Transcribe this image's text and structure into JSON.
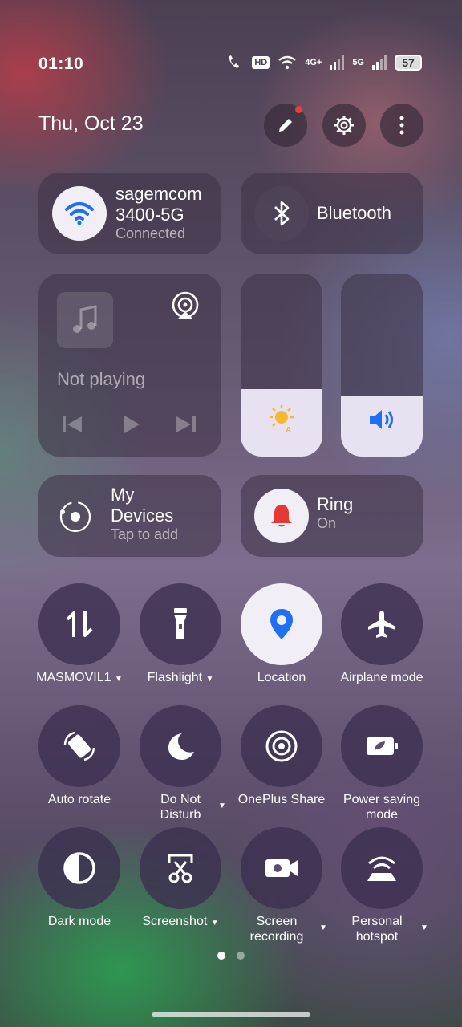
{
  "status_bar": {
    "time": "01:10",
    "hd": "HD",
    "net1": "4G+",
    "net2": "5G",
    "battery": "57"
  },
  "header": {
    "date": "Thu, Oct 23"
  },
  "wifi": {
    "name_line1": "sagemcom",
    "name_line2": "3400-5G",
    "status": "Connected"
  },
  "bluetooth": {
    "label": "Bluetooth"
  },
  "media": {
    "status": "Not playing"
  },
  "sliders": {
    "brightness_level": 0.37,
    "volume_level": 0.33
  },
  "devices": {
    "title_line1": "My",
    "title_line2": "Devices",
    "sub": "Tap to add"
  },
  "ring": {
    "title": "Ring",
    "sub": "On"
  },
  "tiles": {
    "mobile_data": "MASMOVIL1",
    "flashlight": "Flashlight",
    "location": "Location",
    "airplane": "Airplane mode",
    "auto_rotate": "Auto rotate",
    "dnd_line1": "Do Not",
    "dnd_line2": "Disturb",
    "oneplus_share": "OnePlus Share",
    "power_line1": "Power saving",
    "power_line2": "mode",
    "dark_mode": "Dark mode",
    "screenshot": "Screenshot",
    "rec_line1": "Screen",
    "rec_line2": "recording",
    "hotspot_line1": "Personal",
    "hotspot_line2": "hotspot"
  },
  "colors": {
    "accent_blue": "#1e6ff2",
    "ring_red": "#e53935",
    "tile_light": "#f2eef6"
  }
}
